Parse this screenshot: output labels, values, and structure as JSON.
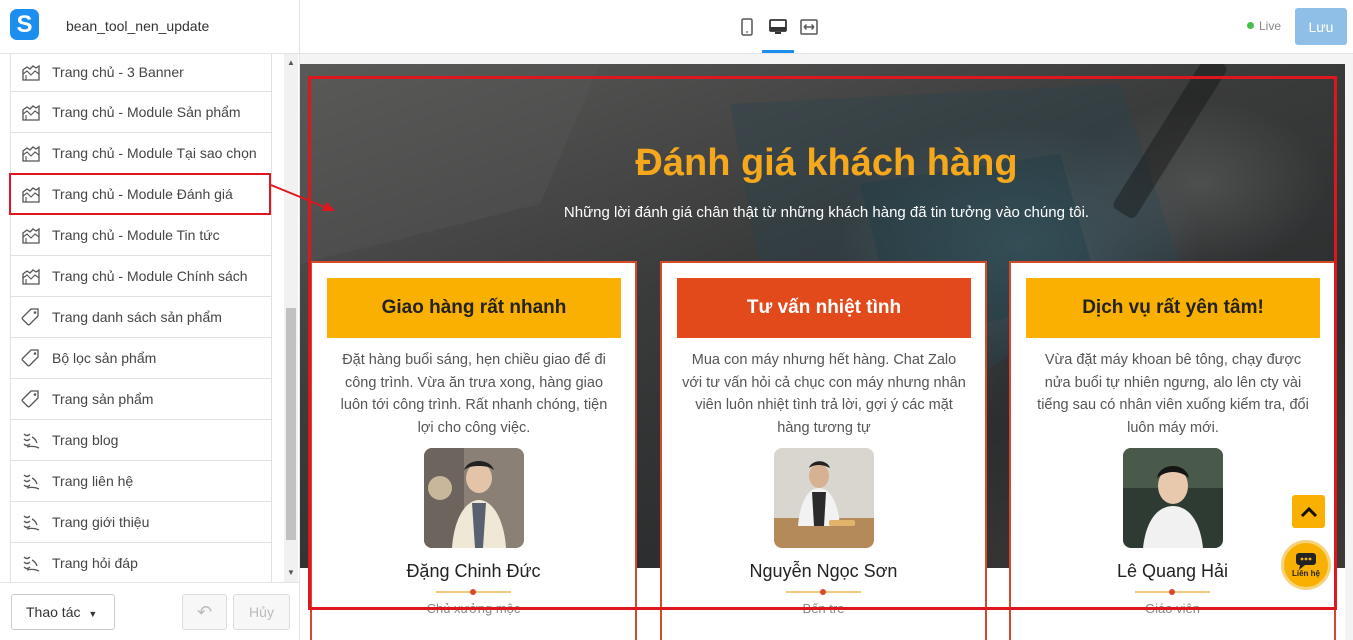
{
  "app": {
    "theme_name": "bean_tool_nen_update",
    "live_label": "Live",
    "save_label": "Lưu",
    "colors": {
      "accent": "#1b8ef0",
      "live": "#46c04a",
      "save_disabled": "#8fbfe6"
    }
  },
  "sidebar": {
    "items": [
      {
        "label": "Trang chủ - 3 Banner",
        "icon": "home-layout-icon"
      },
      {
        "label": "Trang chủ - Module Sản phẩm",
        "icon": "home-layout-icon"
      },
      {
        "label": "Trang chủ - Module Tại sao chọn",
        "icon": "home-layout-icon"
      },
      {
        "label": "Trang chủ - Module Đánh giá",
        "icon": "home-layout-icon",
        "highlighted": true
      },
      {
        "label": "Trang chủ - Module Tin tức",
        "icon": "home-layout-icon"
      },
      {
        "label": "Trang chủ - Module Chính sách",
        "icon": "home-layout-icon"
      },
      {
        "label": "Trang danh sách sản phẩm",
        "icon": "tag-icon"
      },
      {
        "label": "Bộ lọc sản phẩm",
        "icon": "tag-icon"
      },
      {
        "label": "Trang sản phẩm",
        "icon": "tag-icon"
      },
      {
        "label": "Trang blog",
        "icon": "wave-page-icon"
      },
      {
        "label": "Trang liên hệ",
        "icon": "wave-page-icon"
      },
      {
        "label": "Trang giới thiệu",
        "icon": "wave-page-icon"
      },
      {
        "label": "Trang hỏi đáp",
        "icon": "wave-page-icon"
      }
    ],
    "footer": {
      "actions_label": "Thao tác",
      "cancel_label": "Hủy"
    }
  },
  "preview": {
    "section_title": "Đánh giá khách hàng",
    "section_subtitle": "Những lời đánh giá chân thật từ những khách hàng đã tin tưởng vào chúng tôi.",
    "cards": [
      {
        "heading": "Giao hàng rất nhanh",
        "heading_color": "#f9b000",
        "text": "Đặt hàng buổi sáng, hẹn chiều giao để đi công trình. Vừa ăn trưa xong, hàng giao luôn tới công trình. Rất nhanh chóng, tiện lợi cho công việc.",
        "name": "Đặng Chinh Đức",
        "role": "Chủ xưởng mộc"
      },
      {
        "heading": "Tư vấn nhiệt tình",
        "heading_color": "#e24a1c",
        "text": "Mua con máy nhưng hết hàng. Chat Zalo với tư vấn hỏi cả chục con máy nhưng nhân viên luôn nhiệt tình trả lời, gợi ý các mặt hàng tương tự",
        "name": "Nguyễn Ngọc Sơn",
        "role": "Bến tre"
      },
      {
        "heading": "Dịch vụ rất yên tâm!",
        "heading_color": "#f9b000",
        "text": "Vừa đặt máy khoan bê tông, chạy được nửa buổi tự nhiên ngưng, alo lên cty vài tiếng sau có nhân viên xuống kiểm tra, đổi luôn máy mới.",
        "name": "Lê Quang Hải",
        "role": "Giáo viên"
      }
    ],
    "contact_label": "Liên hệ"
  }
}
